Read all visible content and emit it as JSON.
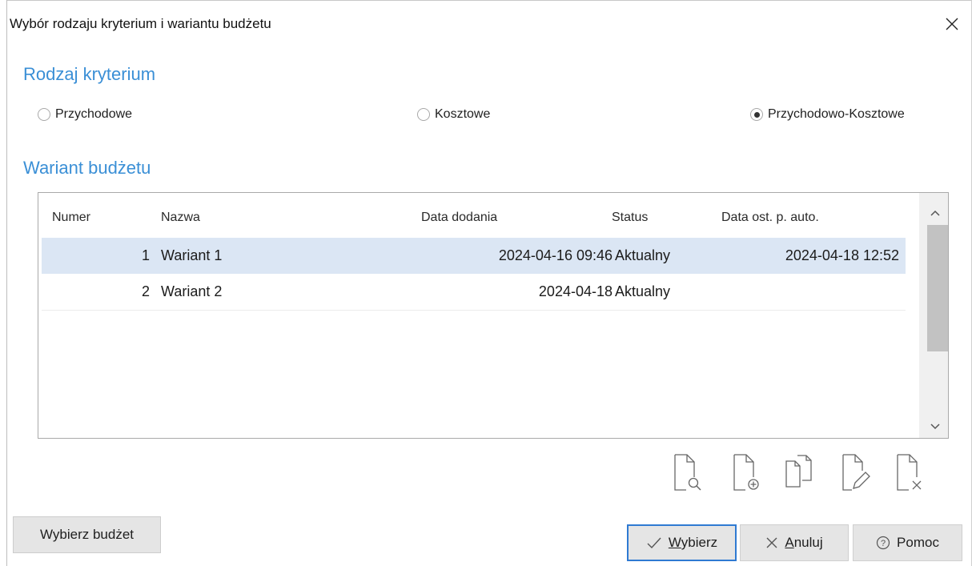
{
  "window": {
    "title": "Wybór rodzaju kryterium i wariantu budżetu"
  },
  "criteria": {
    "heading": "Rodzaj kryterium",
    "options": [
      {
        "label": "Przychodowe",
        "selected": false
      },
      {
        "label": "Kosztowe",
        "selected": false
      },
      {
        "label": "Przychodowo-Kosztowe",
        "selected": true
      }
    ]
  },
  "variants": {
    "heading": "Wariant budżetu",
    "columns": [
      "Numer",
      "Nazwa",
      "Data dodania",
      "Status",
      "Data ost. p. auto."
    ],
    "rows": [
      {
        "numer": "1",
        "nazwa": "Wariant 1",
        "data_dodania": "2024-04-16 09:46",
        "status": "Aktualny",
        "data_ost": "2024-04-18 12:52",
        "selected": true
      },
      {
        "numer": "2",
        "nazwa": "Wariant 2",
        "data_dodania": "2024-04-18",
        "status": "Aktualny",
        "data_ost": "",
        "selected": false
      }
    ]
  },
  "toolbar_icons": [
    "preview-document-icon",
    "add-document-icon",
    "copy-document-icon",
    "edit-document-icon",
    "delete-document-icon"
  ],
  "buttons": {
    "wybierz_budzet": "Wybierz budżet",
    "wybierz_first": "W",
    "wybierz_rest": "ybierz",
    "anuluj_first": "A",
    "anuluj_rest": "nuluj",
    "pomoc": "Pomoc"
  },
  "colors": {
    "accent": "#3a8fd6",
    "selection": "#dbe6f4",
    "default_button_border": "#2f7ad2"
  }
}
